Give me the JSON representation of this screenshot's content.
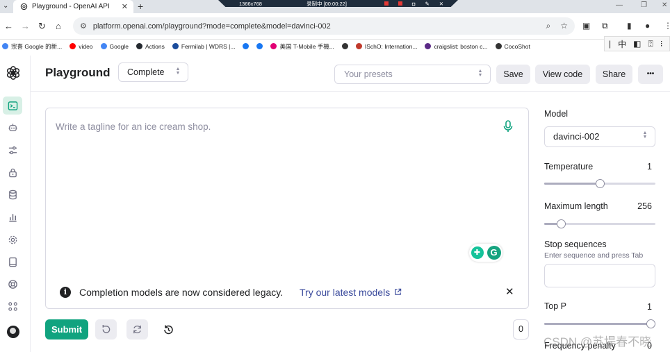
{
  "browser": {
    "tab_title": "Playground - OpenAI API",
    "recorder_resolution": "1366x768",
    "recorder_status": "录制中 [00:00:22]",
    "url": "platform.openai.com/playground?mode=complete&model=davinci-002",
    "bookmarks": [
      {
        "label": "宗喜 Google 的新...",
        "color": "#4285f4"
      },
      {
        "label": "video",
        "color": "#ff0000"
      },
      {
        "label": "Google",
        "color": "#4285f4"
      },
      {
        "label": "Actions",
        "color": "#24292f"
      },
      {
        "label": "Fermilab | WDRS |...",
        "color": "#1a4c9c"
      },
      {
        "label": "",
        "color": "#1877f2"
      },
      {
        "label": "",
        "color": "#1877f2"
      },
      {
        "label": "美国 T-Mobile 手機...",
        "color": "#e20074"
      },
      {
        "label": "",
        "color": "#333333"
      },
      {
        "label": "ISchO: Internation...",
        "color": "#c0392b"
      },
      {
        "label": "craigslist: boston c...",
        "color": "#5b2a86"
      },
      {
        "label": "CocoShot",
        "color": "#333333"
      }
    ],
    "ime_label": "中"
  },
  "app": {
    "title": "Playground",
    "mode": "Complete",
    "presets_placeholder": "Your presets",
    "buttons": {
      "save": "Save",
      "view_code": "View code",
      "share": "Share",
      "more": "•••"
    },
    "prompt_placeholder": "Write a tagline for an ice cream shop.",
    "notice": {
      "message": "Completion models are now considered legacy.",
      "link": "Try our latest models"
    },
    "submit": "Submit",
    "token_count": "0",
    "accent_color": "#10a37f"
  },
  "settings": {
    "model_label": "Model",
    "model_value": "davinci-002",
    "temperature": {
      "label": "Temperature",
      "value": "1",
      "fraction": 0.5
    },
    "max_length": {
      "label": "Maximum length",
      "value": "256",
      "fraction": 0.12
    },
    "stop_sequences": {
      "label": "Stop sequences",
      "hint": "Enter sequence and press Tab"
    },
    "top_p": {
      "label": "Top P",
      "value": "1",
      "fraction": 1.0
    },
    "frequency_penalty": {
      "label": "Frequency penalty",
      "value": "0"
    }
  },
  "watermark": "CSDN @苏堤春不晓"
}
